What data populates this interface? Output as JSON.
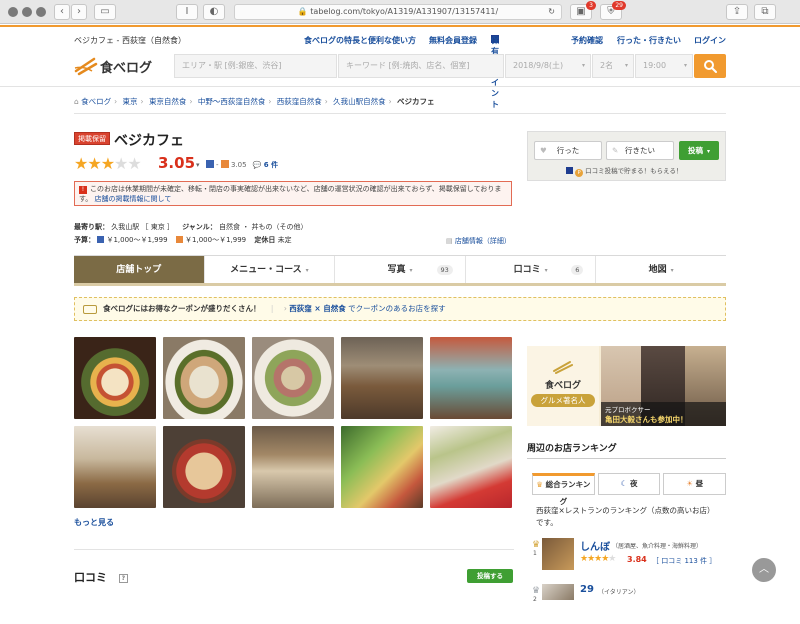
{
  "browser": {
    "url": "tabelog.com/tokyo/A1319/A131907/13157411/",
    "badge1": "3",
    "badge2": "29"
  },
  "header": {
    "store_tag": "ベジカフェ - 西荻窪（自然食）",
    "links": [
      "食べログの特長と便利な使い方",
      "無料会員登録",
      "保有Tポイント",
      "予約確認",
      "行った・行きたい",
      "ログイン"
    ],
    "logo_text": "食べログ",
    "search": {
      "area_placeholder": "エリア・駅 [例:銀座、渋谷]",
      "keyword_placeholder": "キーワード [例:焼肉、店名、個室]",
      "date": "2018/9/8(土)",
      "people": "2名",
      "time": "19:00"
    }
  },
  "breadcrumbs": [
    "食べログ",
    "東京",
    "東京自然食",
    "中野〜西荻窪自然食",
    "西荻窪自然食",
    "久我山駅自然食",
    "ベジカフェ"
  ],
  "shop": {
    "hozon_label": "掲載保留",
    "name": "ベジカフェ",
    "rating": "3.05",
    "sub_rating": "- ",
    "sub_rating2": "3.05",
    "review_count": "6 件",
    "alert": "このお店は休業期間が未確定、移転・閉店の事実確認が出来ないなど、店舗の運営状況の確認が出来ておらず、掲載保留しております。",
    "alert_link": "店舗の掲載情報に関して",
    "station_label": "最寄り駅：",
    "station": "久我山駅",
    "area": "［ 東京 ］",
    "genre_label": "ジャンル：",
    "genre": "自然食 ・ 丼もの（その他）",
    "budget_label": "予算：",
    "budget_dinner": "￥1,000～￥1,999",
    "budget_lunch": "￥1,000～￥1,999",
    "holiday_label": "定休日",
    "holiday": "未定",
    "detail_link": "店舗情報（詳細）"
  },
  "tabs": [
    {
      "label": "店舗トップ",
      "count": ""
    },
    {
      "label": "メニュー・コース",
      "count": ""
    },
    {
      "label": "写真",
      "count": "93"
    },
    {
      "label": "口コミ",
      "count": "6"
    },
    {
      "label": "地図",
      "count": ""
    }
  ],
  "coupon": {
    "text": "食べログにはお得なクーポンが盛りだくさん！",
    "link_area": "西荻窪 × 自然食",
    "link_suffix": " でクーポンのあるお店を探す"
  },
  "photos_more": "もっと見る",
  "reviews_heading": "口コミ",
  "post_review": "投稿する",
  "actions": {
    "went": "行った",
    "want": "行きたい",
    "post": "投稿",
    "tpoint_note": "口コミ投稿で貯まる！もらえる！"
  },
  "banner": {
    "logo": "食べログ",
    "sub": "グルメ著名人",
    "caption1": "元プロボクサー",
    "caption2": "亀田大毅さんも参加中！"
  },
  "ranking": {
    "title": "周辺のお店ランキング",
    "tabs": [
      "総合ランキング",
      "夜",
      "昼"
    ],
    "desc": "西荻窪×レストランのランキング（点数の高いお店）です。",
    "items": [
      {
        "rank": "1",
        "name": "しんぼ",
        "genre": "（居酒屋、魚介料理・海鮮料理）",
        "score": "3.84",
        "reviews": "［ 口コミ 113 件 ］"
      },
      {
        "rank": "2",
        "name": "29",
        "genre": "（イタリアン）",
        "score": "",
        "reviews": ""
      }
    ]
  },
  "colors": {
    "accent": "#f19a2f",
    "link": "#1a4f9c",
    "score_red": "#d9301b",
    "tab_active": "#7b6b45",
    "post_green": "#3f9f33"
  }
}
